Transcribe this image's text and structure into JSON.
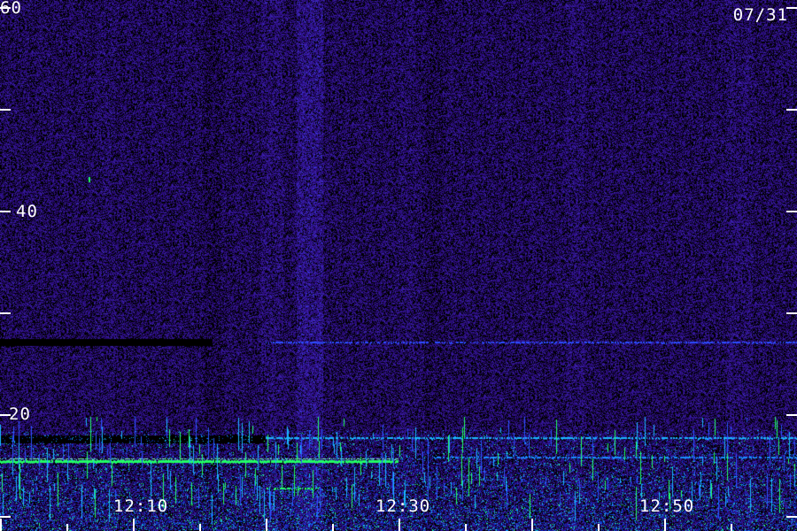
{
  "date_label": "07/31",
  "y_axis": {
    "min": 0,
    "max": 60,
    "labels": [
      {
        "value": 60,
        "text": "60"
      },
      {
        "value": 40,
        "text": "40"
      },
      {
        "value": 20,
        "text": "20"
      }
    ],
    "tick_values": [
      60,
      50,
      40,
      30,
      20,
      10
    ]
  },
  "x_axis": {
    "labels": [
      {
        "minutes": 10,
        "text": "12:10"
      },
      {
        "minutes": 30,
        "text": "12:30"
      },
      {
        "minutes": 50,
        "text": "12:50"
      }
    ]
  },
  "colors": {
    "background": "#000000",
    "noise_low": "#2a0a6e",
    "noise_high": "#3b26c8",
    "signal_cyan": "#1ab8ff",
    "signal_green": "#22ff66",
    "text": "#ffffff"
  }
}
